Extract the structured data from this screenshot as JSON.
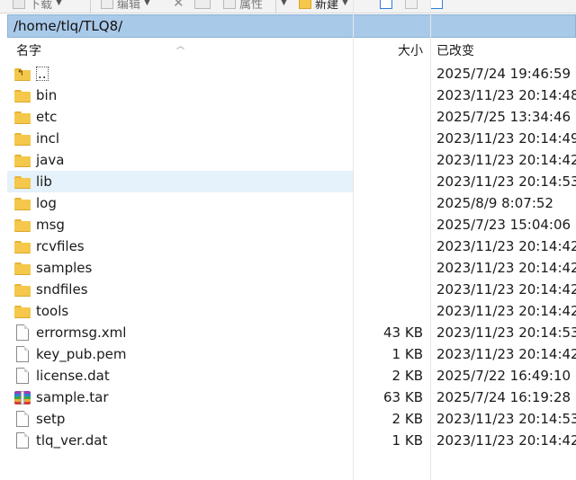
{
  "toolbar": {
    "download_label": "下载",
    "edit_label": "编辑",
    "properties_label": "属性",
    "new_label": "新建"
  },
  "path": "/home/tlq/TLQ8/",
  "columns": {
    "name": "名字",
    "size": "大小",
    "modified": "已改变"
  },
  "files": [
    {
      "name": "..",
      "type": "parent-folder",
      "size": "",
      "modified": "2025/7/24 19:46:59"
    },
    {
      "name": "bin",
      "type": "folder",
      "size": "",
      "modified": "2023/11/23 20:14:48"
    },
    {
      "name": "etc",
      "type": "folder",
      "size": "",
      "modified": "2025/7/25 13:34:46"
    },
    {
      "name": "incl",
      "type": "folder",
      "size": "",
      "modified": "2023/11/23 20:14:49"
    },
    {
      "name": "java",
      "type": "folder",
      "size": "",
      "modified": "2023/11/23 20:14:42"
    },
    {
      "name": "lib",
      "type": "folder",
      "size": "",
      "modified": "2023/11/23 20:14:53",
      "selected": true
    },
    {
      "name": "log",
      "type": "folder",
      "size": "",
      "modified": "2025/8/9 8:07:52"
    },
    {
      "name": "msg",
      "type": "folder",
      "size": "",
      "modified": "2025/7/23 15:04:06"
    },
    {
      "name": "rcvfiles",
      "type": "folder",
      "size": "",
      "modified": "2023/11/23 20:14:42"
    },
    {
      "name": "samples",
      "type": "folder",
      "size": "",
      "modified": "2023/11/23 20:14:42"
    },
    {
      "name": "sndfiles",
      "type": "folder",
      "size": "",
      "modified": "2023/11/23 20:14:42"
    },
    {
      "name": "tools",
      "type": "folder",
      "size": "",
      "modified": "2023/11/23 20:14:42"
    },
    {
      "name": "errormsg.xml",
      "type": "file",
      "size": "43 KB",
      "modified": "2023/11/23 20:14:53"
    },
    {
      "name": "key_pub.pem",
      "type": "file",
      "size": "1 KB",
      "modified": "2023/11/23 20:14:42"
    },
    {
      "name": "license.dat",
      "type": "file",
      "size": "2 KB",
      "modified": "2025/7/22 16:49:10"
    },
    {
      "name": "sample.tar",
      "type": "archive",
      "size": "63 KB",
      "modified": "2025/7/24 16:19:28"
    },
    {
      "name": "setp",
      "type": "file",
      "size": "2 KB",
      "modified": "2023/11/23 20:14:53"
    },
    {
      "name": "tlq_ver.dat",
      "type": "file",
      "size": "1 KB",
      "modified": "2023/11/23 20:14:42"
    }
  ],
  "colors": {
    "path_bar": "#a9c9e9",
    "selection": "#e5f1fb",
    "folder": "#f5c84b"
  }
}
